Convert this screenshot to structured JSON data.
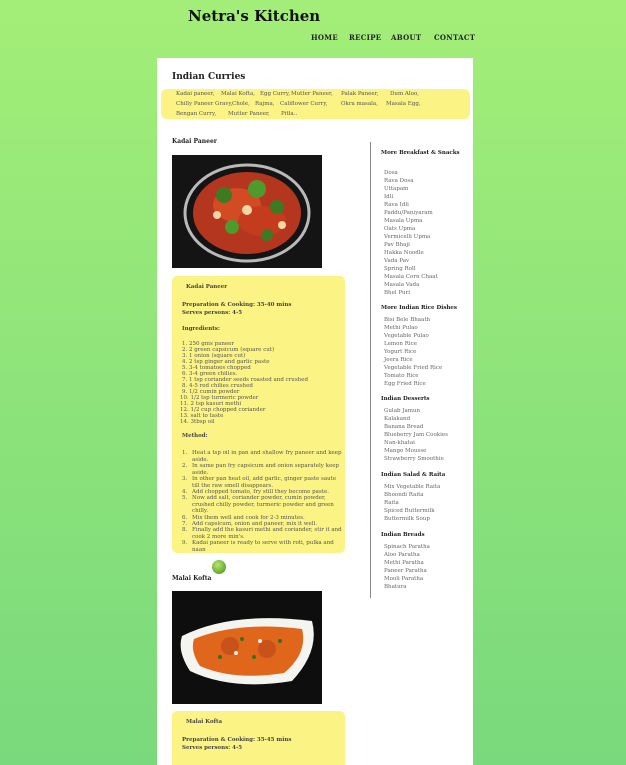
{
  "site": {
    "title": "Netra's Kitchen",
    "nav": [
      "HOME",
      "RECIPE",
      "ABOUT",
      "CONTACT"
    ]
  },
  "main": {
    "section_title": "Indian Curries",
    "tags": [
      "Kadai paneer,",
      "Malai Kofta,",
      "Egg Curry,",
      "Mutter Paneer,",
      "Palak Paneer,",
      "Dum Aloo,",
      "Chilly Paneer Gravy,",
      "Chole,",
      "Rajma,",
      "Califlower Curry,",
      "Okra masala,",
      "Masala Egg,",
      "Bengan Curry,",
      "Mutter Paneer,",
      "Pitla.."
    ]
  },
  "recipes": [
    {
      "heading": "Kadai Paneer",
      "card_title": "Kadai Paneer",
      "prep": "Preparation & Cooking: 35-40 mins",
      "serves": "Serves persons: 4-5",
      "ingredients_label": "Ingredients:",
      "ingredients": [
        "250 gms paneer",
        "2 green capsicum (square cut)",
        "1 onion (square cut)",
        "2 tsp ginger and garlic paste",
        "3-4 tomatoes chopped",
        "3-4 green chilies.",
        "1 tsp coriander seeds roasted and crushed",
        "4-5 red chilies crushed",
        "1/2 cumin powder",
        "1/2 tsp turmeric powder",
        "2 tsp kasuri methi",
        "1/2 cup chopped coriander",
        "salt to taste",
        "3tbsp oil"
      ],
      "method_label": "Method:",
      "method": [
        "Heat a tsp oil in pan and shallow fry paneer and keep aside.",
        "In same pan fry capsicum and onion separately keep aside.",
        "In other pan heat oil, add garlic, ginger paste saute till the raw smell disappears.",
        "Add chopped tomato, fry still they become paste.",
        "Now add salt, coriander powder, cumin powder, crushed chilly powder, turmeric powder and green chilly.",
        "Mix them well and cook for 2-3 minutes.",
        "Add capsicum, onion and paneer, mix it well.",
        "Finally add the kasuri methi and coriander, stir it and cook 2 more min's.",
        "Kadai paneer is ready to serve with roti, pulka and naan"
      ]
    },
    {
      "heading": "Malai Kofta",
      "card_title": "Malai Kofta",
      "prep": "Preparation & Cooking: 35-45 mins",
      "serves": "Serves persons: 4-5"
    }
  ],
  "sidebar": {
    "sections": [
      {
        "title": "More Breakfast & Snacks",
        "items": [
          "Dosa",
          "Rava Dosa",
          "Uttapam",
          "Idli",
          "Rava Idli",
          "Paddu/Paniyaram",
          "Masala Upma",
          "Oats Upma",
          "Vermicelli Upma",
          "Pav Bhaji",
          "Hakka Noodle",
          "Vada Pav",
          "Spring Roll",
          "Masala Corn Chaat",
          "Masala Vada",
          "Bhel Puri"
        ]
      },
      {
        "title": "More Indian Rice Dishes",
        "items": [
          "Bisi Bele Bhaath",
          "Methi Pulao",
          "Vegetable Pulao",
          "Lemon Rice",
          "Yogurt Rice",
          "Jeera Rice",
          "Vegetable Fried Rice",
          "Tomato Rice",
          "Egg Fried Rice"
        ]
      },
      {
        "title": "Indian Desserts",
        "items": [
          "Gulab Jamun",
          "Kalakand",
          "Banana Bread",
          "Blueberry Jam Cookies",
          "Nan-khatai",
          "Mango Mousse",
          "Strawberry Smoothie"
        ]
      },
      {
        "title": "Indian Salad & Raita",
        "items": [
          "Mix Vegetable Raita",
          "Bhoondi Raita",
          "Raita",
          "Spiced Buttermilk",
          "Buttermilk Soup"
        ]
      },
      {
        "title": "Indian Breads",
        "items": [
          "Spinach Paratha",
          "Aloo Paratha",
          "Methi Paratha",
          "Paneer Paratha",
          "Mooli Paratha",
          "Bhatura"
        ]
      }
    ]
  }
}
